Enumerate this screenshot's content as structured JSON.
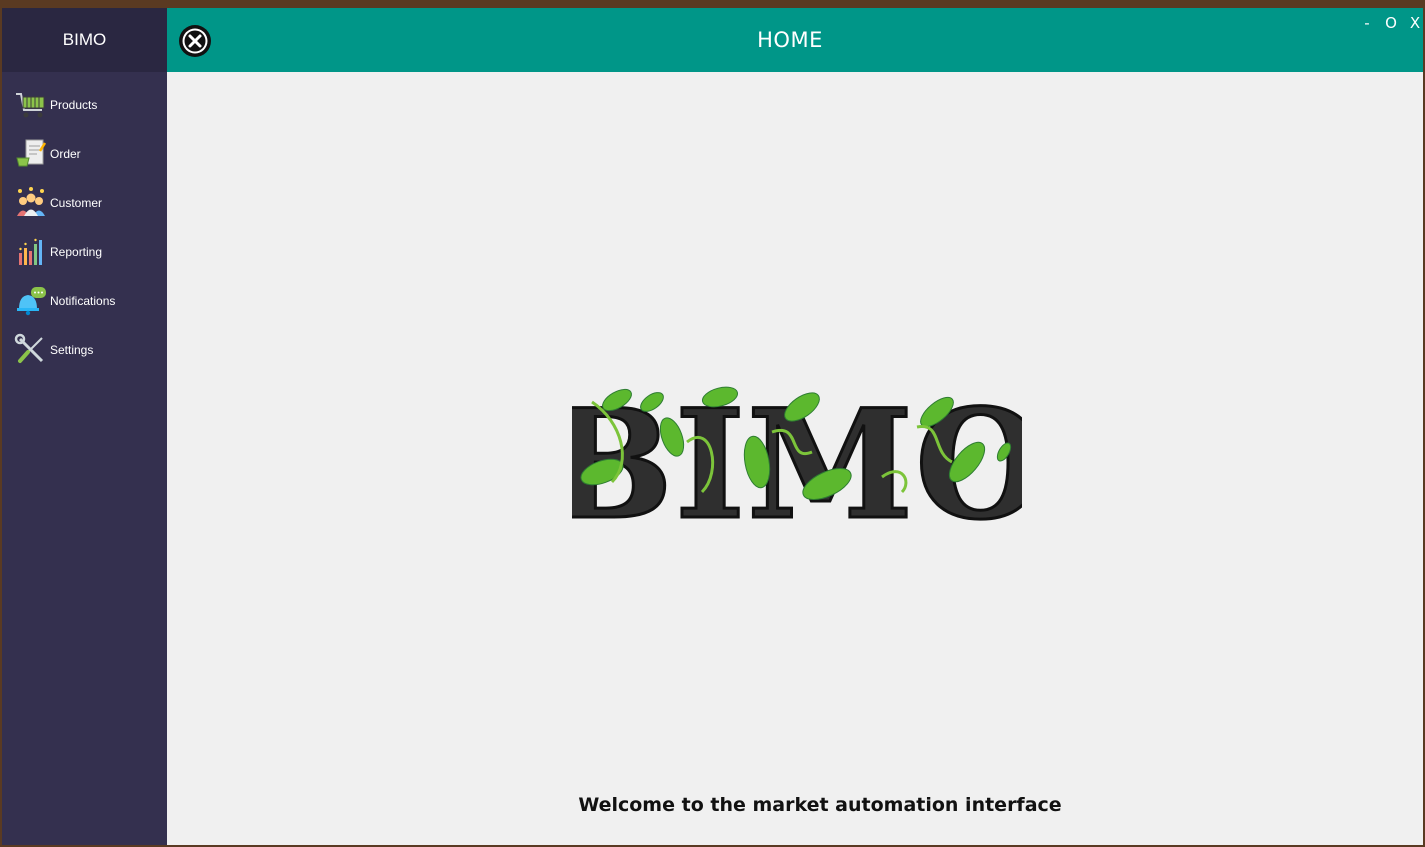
{
  "sidebar": {
    "brand": "BIMO",
    "items": [
      {
        "label": "Products",
        "icon": "shopping-cart-icon"
      },
      {
        "label": "Order",
        "icon": "order-receipt-icon"
      },
      {
        "label": "Customer",
        "icon": "customers-group-icon"
      },
      {
        "label": "Reporting",
        "icon": "bar-chart-icon"
      },
      {
        "label": "Notifications",
        "icon": "bell-chat-icon"
      },
      {
        "label": "Settings",
        "icon": "tools-wrench-screwdriver-icon"
      }
    ]
  },
  "header": {
    "title": "HOME",
    "close_icon": "close-circle-icon",
    "window_controls": {
      "minimize": "-",
      "maximize": "O",
      "close": "X"
    }
  },
  "main": {
    "logo_text": "BIMO",
    "welcome": "Welcome to the market automation interface"
  },
  "colors": {
    "sidebar": "#34304f",
    "sidebar_header": "#2a2741",
    "header": "#009688",
    "main_bg": "#f0f0f0",
    "leaf_green": "#5cb82e",
    "logo_letters": "#2f2f2f"
  }
}
